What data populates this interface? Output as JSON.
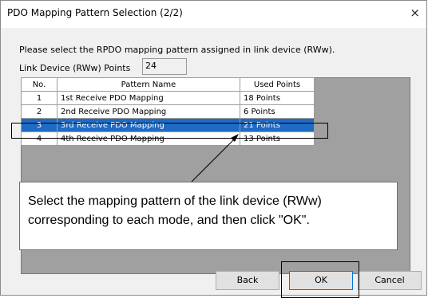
{
  "dialog": {
    "title": "PDO Mapping Pattern Selection (2/2)",
    "close_glyph": "×"
  },
  "prompt": "Please select the RPDO mapping pattern assigned in link device (RWw).",
  "points": {
    "label": "Link Device (RWw) Points",
    "value": "24"
  },
  "table": {
    "headers": [
      "No.",
      "Pattern Name",
      "Used Points"
    ],
    "rows": [
      {
        "no": "1",
        "name": "1st Receive PDO Mapping",
        "points": "18 Points",
        "selected": false
      },
      {
        "no": "2",
        "name": "2nd Receive PDO Mapping",
        "points": "6 Points",
        "selected": false
      },
      {
        "no": "3",
        "name": "3rd Receive PDO Mapping",
        "points": "21 Points",
        "selected": true
      },
      {
        "no": "4",
        "name": "4th Receive PDO Mapping",
        "points": "13 Points",
        "selected": false
      }
    ]
  },
  "callout": "Select the mapping pattern of the link device (RWw) corresponding to each mode, and then click \"OK\".",
  "buttons": {
    "back": "Back",
    "ok": "OK",
    "cancel": "Cancel"
  },
  "colors": {
    "selection": "#1f6bc4",
    "grid_background": "#a0a0a0",
    "dialog_background": "#f0f0f0"
  }
}
